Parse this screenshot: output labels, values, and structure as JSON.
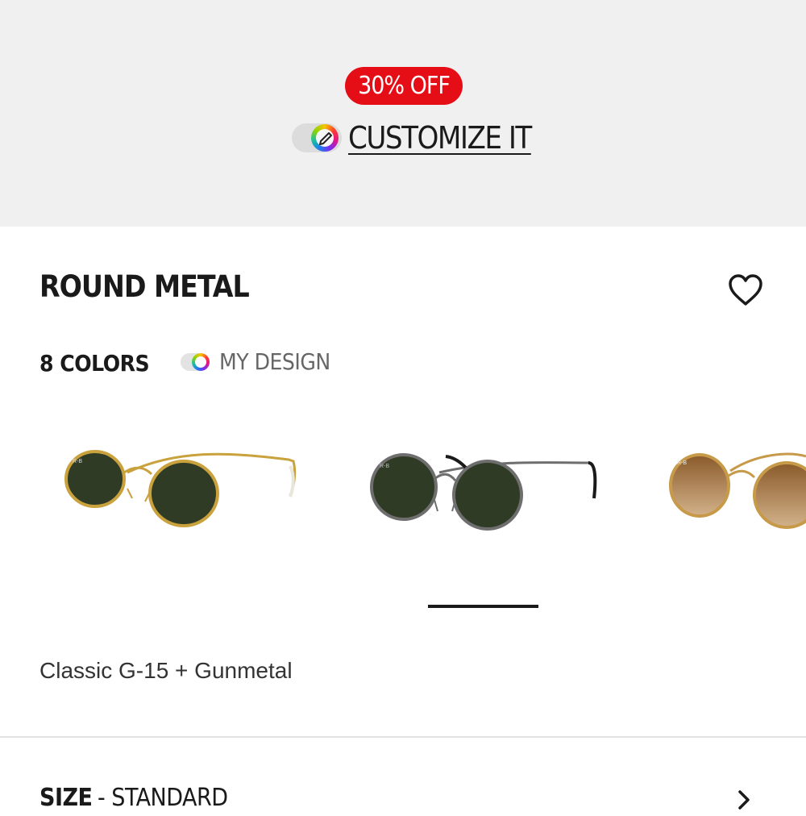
{
  "promo": {
    "badge": "30% OFF",
    "customize_label": "CUSTOMIZE IT"
  },
  "product": {
    "title": "ROUND METAL",
    "colors_count": "8 COLORS",
    "my_design_label": "MY DESIGN",
    "variant_name": "Classic G-15 + Gunmetal"
  },
  "variants": [
    {
      "frame": "#c9a23e",
      "lens": "#2f3b24",
      "temple_tip": "#e9e6dc"
    },
    {
      "frame": "#6e6e6e",
      "lens": "#2f3b24",
      "temple_tip": "#1a1a1a"
    },
    {
      "frame": "#c79a4a",
      "lens": "#9a6a34",
      "temple_tip": "#c79a4a"
    }
  ],
  "carousel": {
    "active_index": 1
  },
  "size": {
    "label": "SIZE",
    "value": "- STANDARD"
  },
  "colors": {
    "badge": "#e60e16",
    "promo_bg": "#f0f0f0",
    "text": "#1a1a1a"
  },
  "icons": {
    "favorite": "heart-icon",
    "customize": "customize-icon",
    "next": "chevron-right-icon"
  }
}
